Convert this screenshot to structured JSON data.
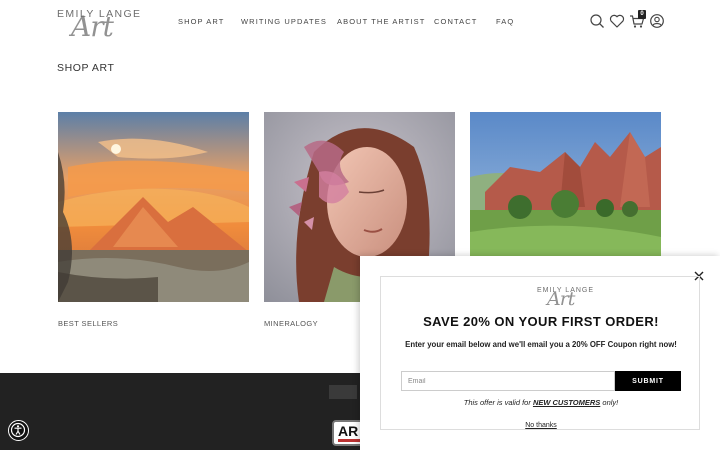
{
  "brand": {
    "logo_top": "EMILY LANGE",
    "logo_script": "Art"
  },
  "nav": {
    "items": [
      {
        "label": "SHOP ART"
      },
      {
        "label": "WRITING UPDATES"
      },
      {
        "label": "ABOUT THE ARTIST"
      },
      {
        "label": "CONTACT"
      },
      {
        "label": "FAQ"
      }
    ]
  },
  "header_icons": {
    "search": "search-icon",
    "wishlist": "heart-icon",
    "cart": "cart-icon",
    "account": "user-icon",
    "cart_count": "0"
  },
  "page": {
    "section_title": "SHOP ART"
  },
  "collections": [
    {
      "label": "BEST SELLERS",
      "image": "sunset-mountain-painting"
    },
    {
      "label": "MINERALOGY",
      "image": "portrait-painting"
    },
    {
      "label": "",
      "image": "red-rocks-landscape-painting"
    }
  ],
  "footer": {
    "badge_text": "AR"
  },
  "popup": {
    "logo_top": "EMILY LANGE",
    "logo_script": "Art",
    "headline": "SAVE 20% ON YOUR FIRST ORDER!",
    "description": "Enter your email below and we'll email you a 20% OFF Coupon right now!",
    "email_placeholder": "Email",
    "submit_label": "SUBMIT",
    "offer_prefix": "This offer is valid for ",
    "offer_highlight": "NEW CUSTOMERS",
    "offer_suffix": " only!",
    "decline_label": "No thanks",
    "close_icon": "close-icon"
  },
  "accessibility": {
    "icon": "accessibility-icon"
  }
}
